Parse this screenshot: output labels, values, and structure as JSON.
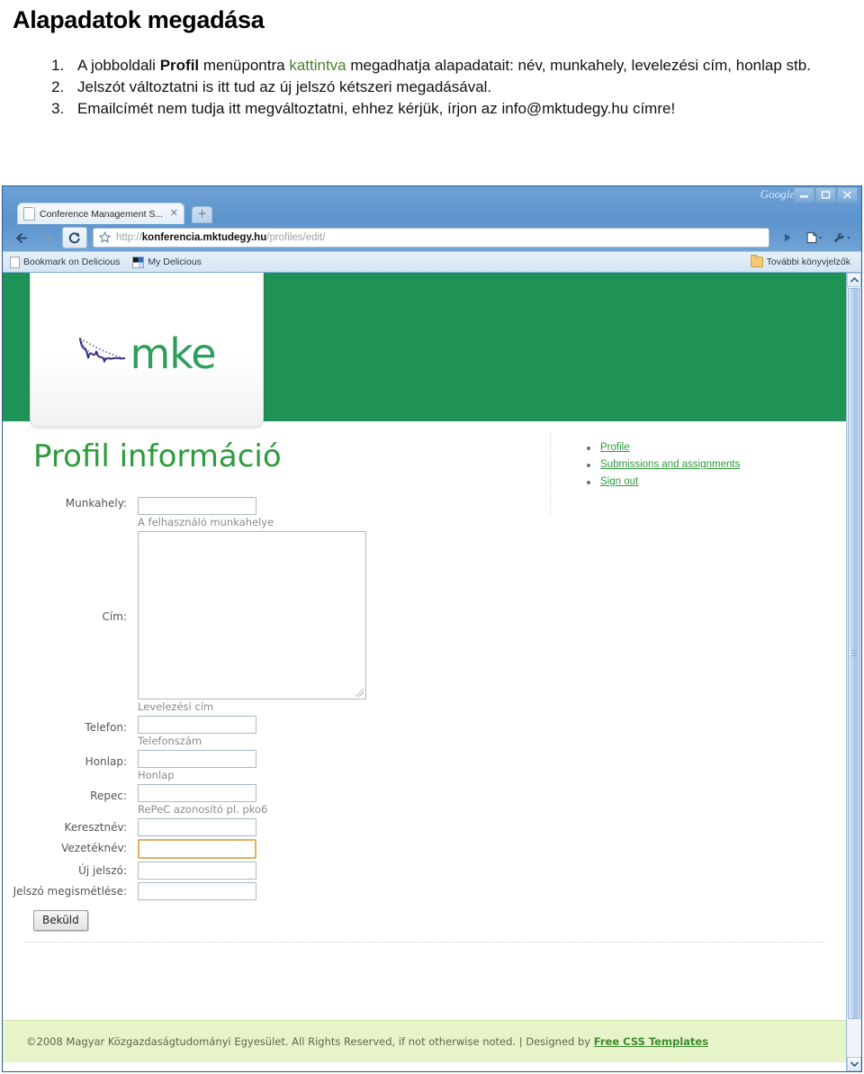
{
  "document": {
    "title": "Alapadatok megadása",
    "items": [
      {
        "parts": [
          {
            "text": "A jobboldali ",
            "style": "normal"
          },
          {
            "text": "Profil",
            "style": "bold"
          },
          {
            "text": " menüpontra ",
            "style": "normal"
          },
          {
            "text": "kattintva",
            "style": "green"
          },
          {
            "text": " megadhatja alapadatait: név, munkahely, levelezési cím, honlap stb.",
            "style": "normal"
          }
        ]
      },
      {
        "parts": [
          {
            "text": "Jelszót változtatni is itt tud az új jelszó kétszeri megadásával.",
            "style": "normal"
          }
        ]
      },
      {
        "parts": [
          {
            "text": "Emailcímét nem tudja itt megváltoztatni, ehhez kérjük, írjon az info@mktudegy.hu címre!",
            "style": "normal"
          }
        ]
      }
    ]
  },
  "browser": {
    "window_brand": "Google",
    "window_buttons": {
      "minimize": "minimize-button",
      "maximize": "maximize-button",
      "close": "close-button"
    },
    "tab": {
      "title": "Conference Management S...",
      "close_label": "✕"
    },
    "new_tab_label": "＋",
    "toolbar": {
      "back_label": "←",
      "forward_label": "→",
      "reload_label": "⟳",
      "go_label": "▶",
      "page_menu_label": "▾",
      "wrench_menu_label": "▾"
    },
    "omnibox": {
      "scheme": "http://",
      "host": "konferencia.mktudegy.hu",
      "path": "/profiles/edit/"
    },
    "bookmarks": [
      {
        "label": "Bookmark on Delicious",
        "icon": "page-icon"
      },
      {
        "label": "My Delicious",
        "icon": "delicious-icon"
      }
    ],
    "other_bookmarks": {
      "label": "További könyvjelzők",
      "icon": "folder-icon"
    }
  },
  "site": {
    "logo_text": "mke",
    "page_title": "Profil információ",
    "menu": [
      {
        "label": "Profile"
      },
      {
        "label": "Submissions and assignments"
      },
      {
        "label": "Sign out"
      }
    ],
    "form": {
      "fields": [
        {
          "label": "Munkahely:",
          "type": "text",
          "value": "",
          "help": "A felhasználó munkahelye",
          "focused": false
        },
        {
          "label": "Cím:",
          "type": "textarea",
          "value": "",
          "help": "Levelezési cím",
          "focused": false
        },
        {
          "label": "Telefon:",
          "type": "text",
          "value": "",
          "help": "Telefonszám",
          "focused": false
        },
        {
          "label": "Honlap:",
          "type": "text",
          "value": "",
          "help": "Honlap",
          "focused": false
        },
        {
          "label": "Repec:",
          "type": "text",
          "value": "",
          "help": "RePeC azonosító pl. pko6",
          "focused": false
        },
        {
          "label": "Keresztnév:",
          "type": "text",
          "value": "",
          "help": "",
          "focused": false
        },
        {
          "label": "Vezetéknév:",
          "type": "text",
          "value": "",
          "help": "",
          "focused": true
        },
        {
          "label": "Új jelszó:",
          "type": "text",
          "value": "",
          "help": "",
          "focused": false
        },
        {
          "label": "Jelszó megismétlése:",
          "type": "text",
          "value": "",
          "help": "",
          "focused": false
        }
      ],
      "submit_label": "Beküld"
    },
    "footer": {
      "text": "©2008 Magyar Közgazdaságtudományi Egyesület. All Rights Reserved, if not otherwise noted. | Designed by ",
      "link_label": "Free CSS Templates"
    }
  },
  "colors": {
    "masthead_green": "#1e9355",
    "title_green": "#2b9c3a",
    "link_green": "#2f9b3d",
    "footer_bg": "#e7f3c9",
    "focus_border": "#d8b362",
    "doc_green": "#4a7d2c"
  }
}
